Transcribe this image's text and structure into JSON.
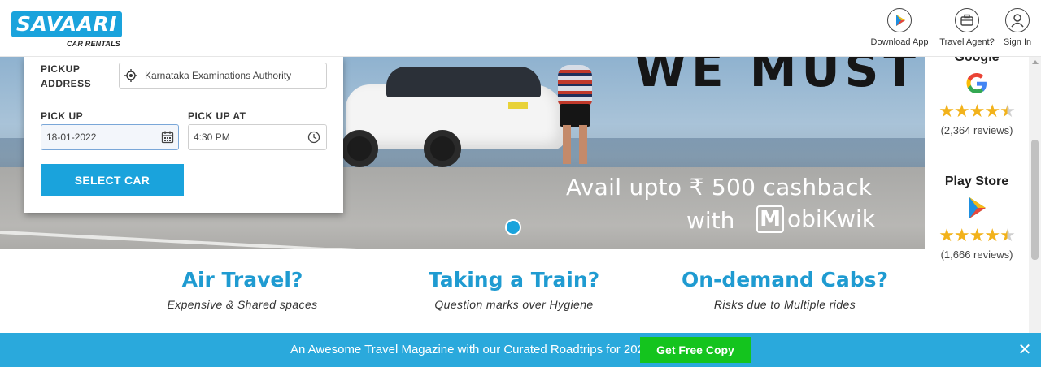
{
  "header": {
    "logo_text": "SAVAARI",
    "logo_sub": "CAR RENTALS",
    "download_app": "Download App",
    "travel_agent": "Travel Agent?",
    "sign_in": "Sign In"
  },
  "hero": {
    "headline_fragment": "WE MUST",
    "cashback_line": "Avail upto ₹ 500 cashback",
    "with": "with",
    "brand_mark": "M",
    "brand_rest": "obiKwik"
  },
  "booking": {
    "pickup_address_label": "PICKUP ADDRESS",
    "pickup_address_value": "Karnataka Examinations Authority",
    "pickup_date_label": "PICK UP",
    "pickup_date_value": "18-01-2022",
    "pickup_time_label": "PICK UP AT",
    "pickup_time_value": "4:30 PM",
    "select_car": "SELECT CAR"
  },
  "ratings": [
    {
      "source": "Google",
      "stars": "★★★★",
      "half_star": "★",
      "count": "(2,364 reviews)"
    },
    {
      "source": "Play Store",
      "stars": "★★★★",
      "half_star": "★",
      "count": "(1,666 reviews)"
    }
  ],
  "features": [
    {
      "title": "Air Travel?",
      "subtitle": "Expensive & Shared spaces"
    },
    {
      "title": "Taking a Train?",
      "subtitle": "Question marks over Hygiene"
    },
    {
      "title": "On-demand Cabs?",
      "subtitle": "Risks due to Multiple rides"
    }
  ],
  "banner": {
    "text": "An Awesome Travel Magazine with our Curated Roadtrips for 2022",
    "button": "Get Free Copy",
    "close": "✕"
  },
  "colors": {
    "brand_blue": "#1aa3dc",
    "feature_blue": "#1f9bd1",
    "cta_green": "#14c41e",
    "star_gold": "#f2b21b"
  }
}
